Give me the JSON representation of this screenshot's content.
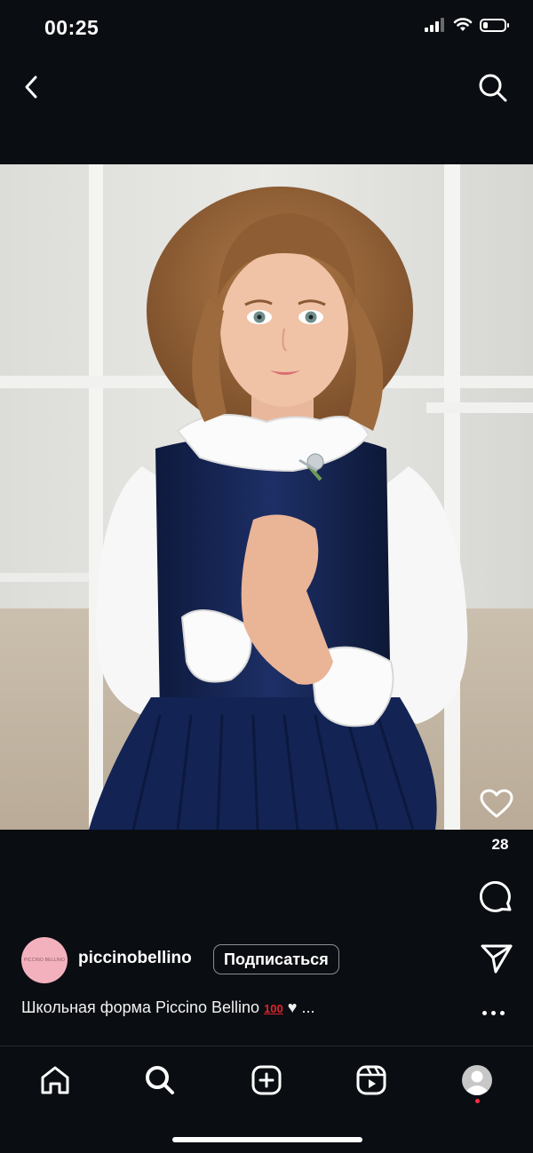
{
  "status_bar": {
    "time": "00:25"
  },
  "post": {
    "like_count": "28",
    "author": {
      "username": "piccinobellino",
      "avatar_text": "PICCINO BELLINO"
    },
    "follow_label": "Подписаться",
    "caption_text": "Школьная форма Piccino Bellino",
    "caption_emoji": "100",
    "caption_tail": "♥ ..."
  },
  "icons": {
    "back": "chevron-left-icon",
    "search": "search-icon",
    "like": "heart-icon",
    "comment": "comment-icon",
    "share": "paper-plane-icon",
    "more": "more-icon",
    "tabs": [
      "home-icon",
      "search-icon",
      "create-icon",
      "reels-icon",
      "profile-icon"
    ]
  },
  "colors": {
    "background": "#0a0d12",
    "avatar": "#f3b1bd",
    "notification_dot": "#ff3040"
  }
}
